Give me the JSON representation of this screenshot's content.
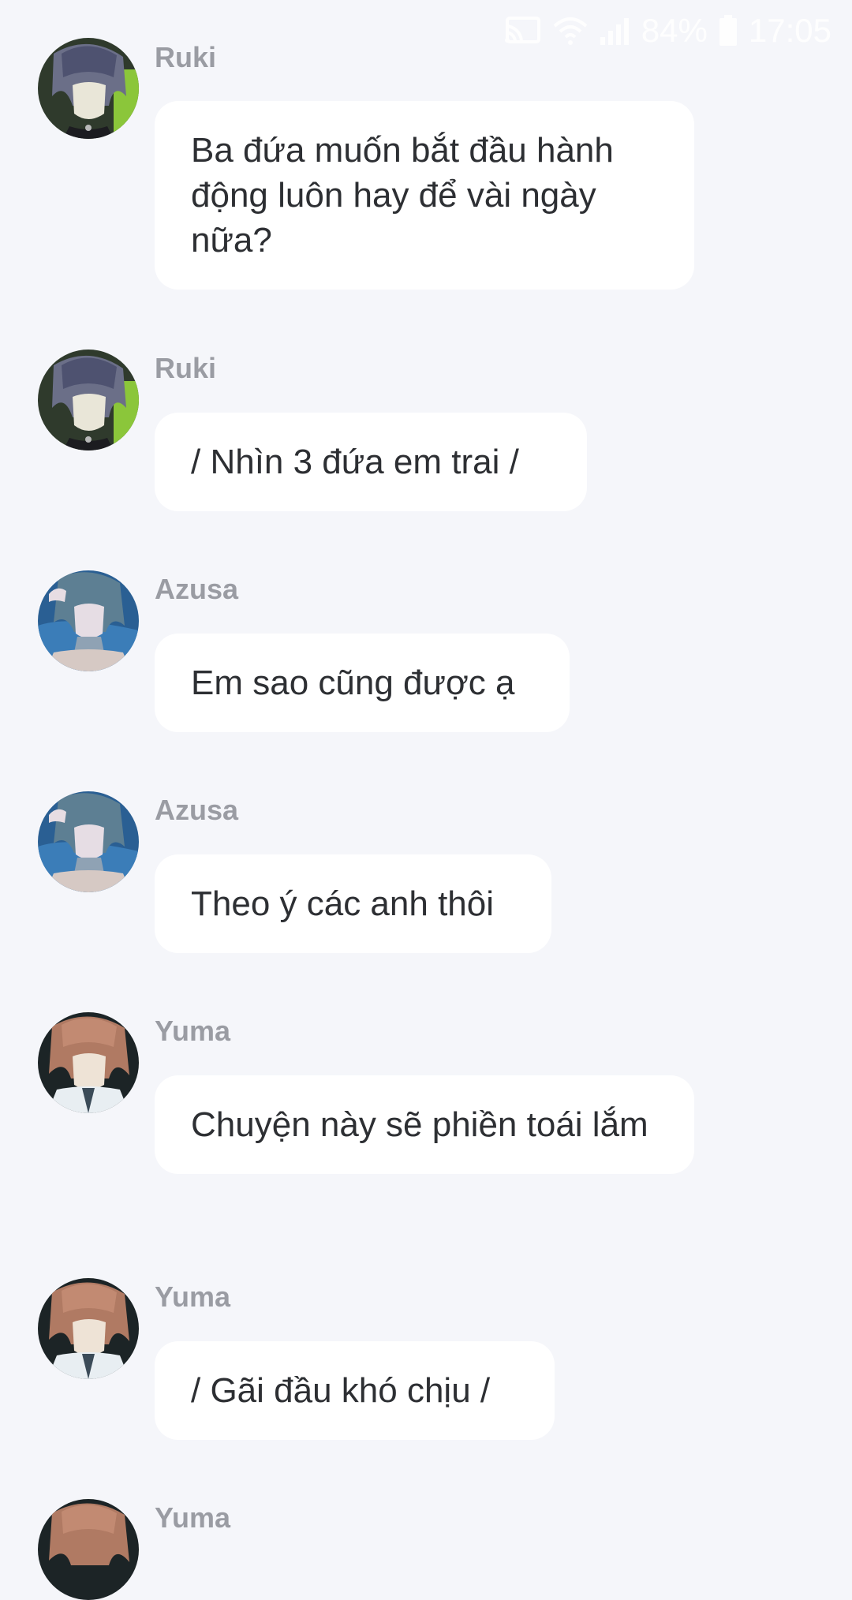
{
  "status_bar": {
    "battery": "84%",
    "time": "17:05",
    "icons": [
      "cast-icon",
      "wifi-icon",
      "signal-icon",
      "battery-icon"
    ]
  },
  "colors": {
    "background": "#f5f6fa",
    "bubble": "#ffffff",
    "sender_name": "#9a9ca3",
    "message_text": "#2d2f33"
  },
  "messages": [
    {
      "sender": "Ruki",
      "avatar": "ruki-avatar",
      "text": "Ba đứa muốn bắt đầu hành động luôn hay để vài ngày nữa?"
    },
    {
      "sender": "Ruki",
      "avatar": "ruki-avatar",
      "text": "/ Nhìn 3 đứa em trai /"
    },
    {
      "sender": "Azusa",
      "avatar": "azusa-avatar",
      "text": "Em sao cũng được ạ"
    },
    {
      "sender": "Azusa",
      "avatar": "azusa-avatar",
      "text": "Theo ý các anh thôi"
    },
    {
      "sender": "Yuma",
      "avatar": "yuma-avatar",
      "text": "Chuyện này sẽ phiền toái lắm"
    },
    {
      "sender": "Yuma",
      "avatar": "yuma-avatar",
      "text": "/ Gãi đầu khó chịu /"
    },
    {
      "sender": "Yuma",
      "avatar": "yuma-avatar",
      "text": ""
    }
  ]
}
